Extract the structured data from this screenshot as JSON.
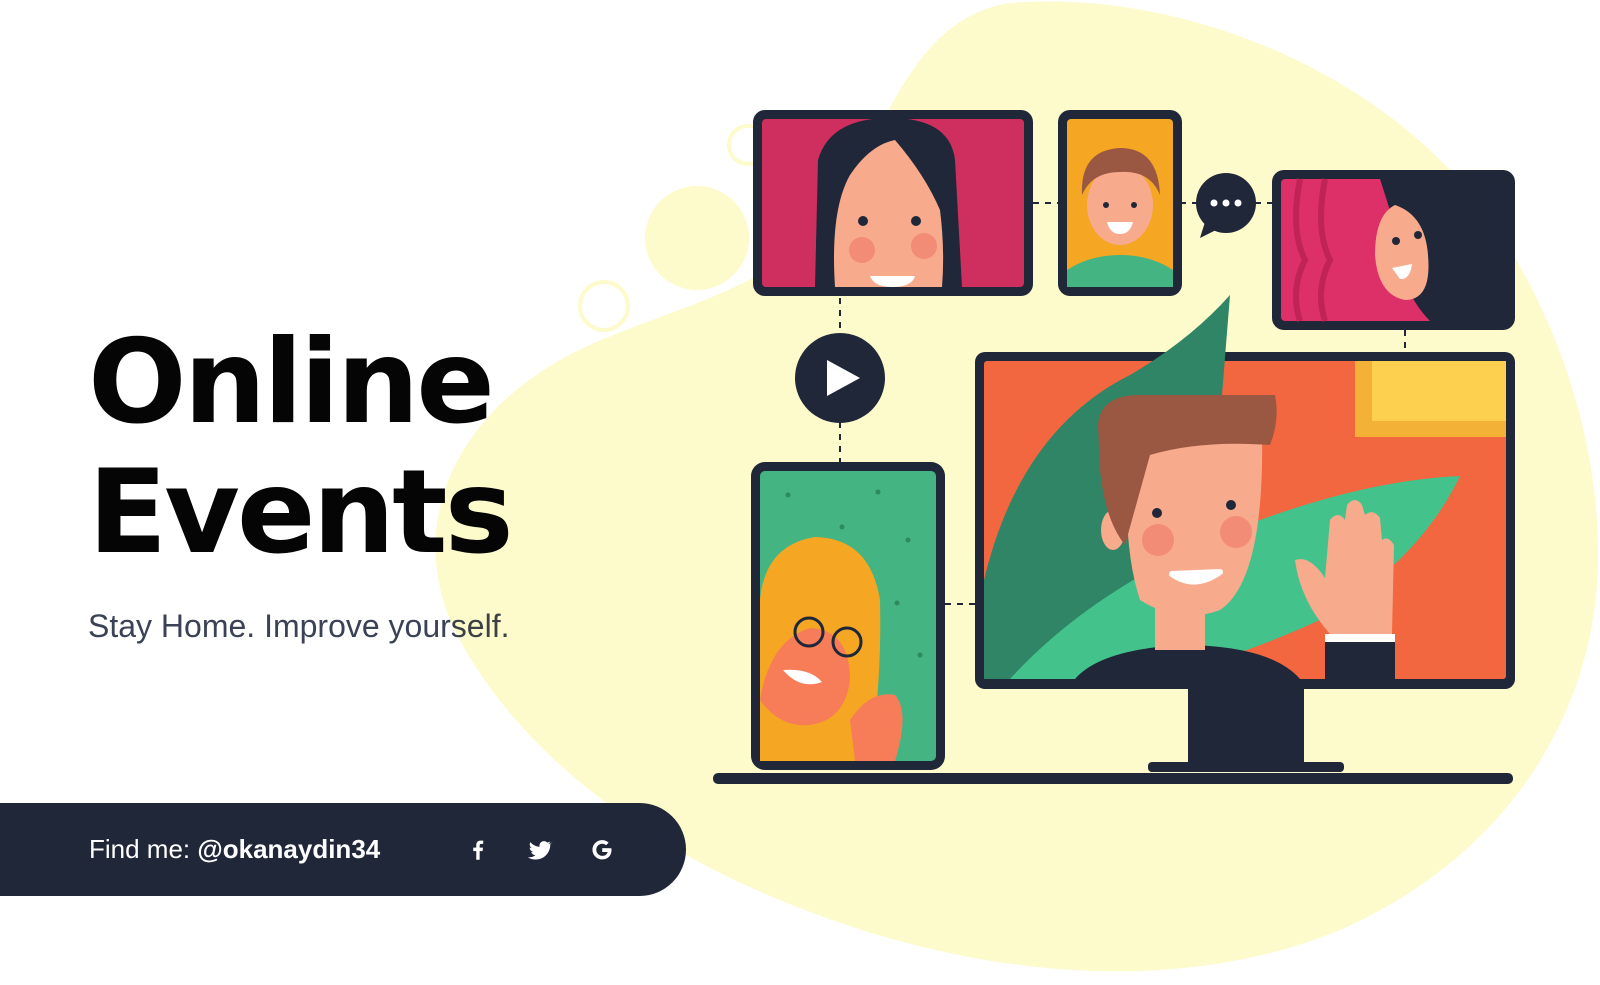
{
  "hero": {
    "title_line1": "Online",
    "title_line2": "Events",
    "tagline": "Stay Home. Improve yourself."
  },
  "footer": {
    "prefix": "Find me: ",
    "handle": "@okanaydin34",
    "social": [
      {
        "name": "facebook",
        "icon": "facebook-icon"
      },
      {
        "name": "twitter",
        "icon": "twitter-icon"
      },
      {
        "name": "google",
        "icon": "google-icon"
      }
    ]
  },
  "colors": {
    "blob": "#fdfacc",
    "navy": "#1f2739",
    "crimson": "#cf2f5f",
    "orange": "#f26640",
    "green": "#44b482",
    "yellow": "#f5a623"
  }
}
